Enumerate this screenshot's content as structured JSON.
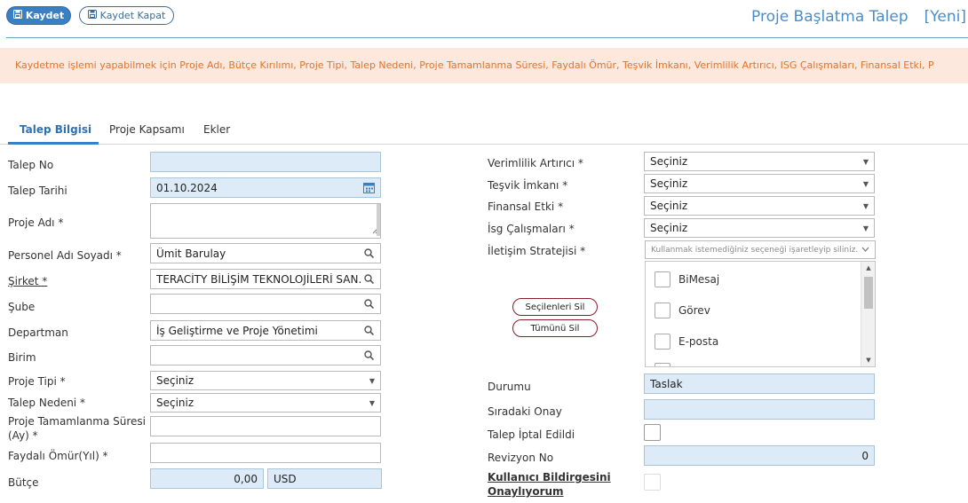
{
  "toolbar": {
    "save_label": "Kaydet",
    "save_close_label": "Kaydet Kapat"
  },
  "header": {
    "title": "Proje Başlatma Talep",
    "status": "[Yeni]"
  },
  "warning": "Kaydetme işlemi yapabilmek için Proje Adı, Bütçe Kırılımı, Proje Tipi, Talep Nedeni, Proje Tamamlanma Süresi, Faydalı Ömür, Teşvik İmkanı, Verimlilik Artırıcı, ISG Çalışmaları, Finansal Etki, P",
  "tabs": [
    "Talep Bilgisi",
    "Proje Kapsamı",
    "Ekler"
  ],
  "left": {
    "talep_no": {
      "label": "Talep No",
      "value": ""
    },
    "talep_tarihi": {
      "label": "Talep Tarihi",
      "value": "01.10.2024"
    },
    "proje_adi": {
      "label": "Proje Adı *",
      "value": ""
    },
    "personel": {
      "label": "Personel Adı Soyadı *",
      "value": "Ümit Barulay"
    },
    "sirket": {
      "label": "Şirket *",
      "value": "TERACİTY BİLİŞİM TEKNOLOJİLERİ SAN. T"
    },
    "sube": {
      "label": "Şube",
      "value": ""
    },
    "departman": {
      "label": "Departman",
      "value": "İş Geliştirme ve Proje Yönetimi"
    },
    "birim": {
      "label": "Birim",
      "value": ""
    },
    "proje_tipi": {
      "label": "Proje Tipi *",
      "value": "Seçiniz"
    },
    "talep_nedeni": {
      "label": "Talep Nedeni *",
      "value": "Seçiniz"
    },
    "tamamlanma": {
      "label_line1": "Proje Tamamlanma Süresi",
      "label_line2": "(Ay) *",
      "value": ""
    },
    "faydali_omur": {
      "label": "Faydalı Ömür(Yıl) *",
      "value": ""
    },
    "butce": {
      "label": "Bütçe",
      "amount": "0,00",
      "currency": "USD"
    }
  },
  "right": {
    "verimlilik": {
      "label": "Verimlilik Artırıcı *",
      "value": "Seçiniz"
    },
    "tesvik": {
      "label": "Teşvik İmkanı *",
      "value": "Seçiniz"
    },
    "finansal": {
      "label": "Finansal Etki *",
      "value": "Seçiniz"
    },
    "isg": {
      "label": "İsg Çalışmaları *",
      "value": "Seçiniz"
    },
    "iletisim": {
      "label": "İletişim Stratejisi *",
      "placeholder": "Kullanmak istemediğiniz seçeneği işaretleyip siliniz."
    },
    "secilenleri_sil": "Seçilenleri Sil",
    "tumunu_sil": "Tümünü Sil",
    "options": [
      "BiMesaj",
      "Görev",
      "E-posta"
    ],
    "durumu": {
      "label": "Durumu",
      "value": "Taslak"
    },
    "siradaki_onay": {
      "label": "Sıradaki Onay",
      "value": ""
    },
    "talep_iptal": {
      "label": "Talep İptal Edildi"
    },
    "revizyon": {
      "label": "Revizyon No",
      "value": "0"
    },
    "kullanici": {
      "label_line1": "Kullanıcı Bildirgesini",
      "label_line2": "Onaylıyorum"
    }
  },
  "colors": {
    "accent": "#3a7fc1",
    "warning_bg": "#fce8dc",
    "warning_text": "#e0742e",
    "readonly_bg": "#dcebf7"
  }
}
